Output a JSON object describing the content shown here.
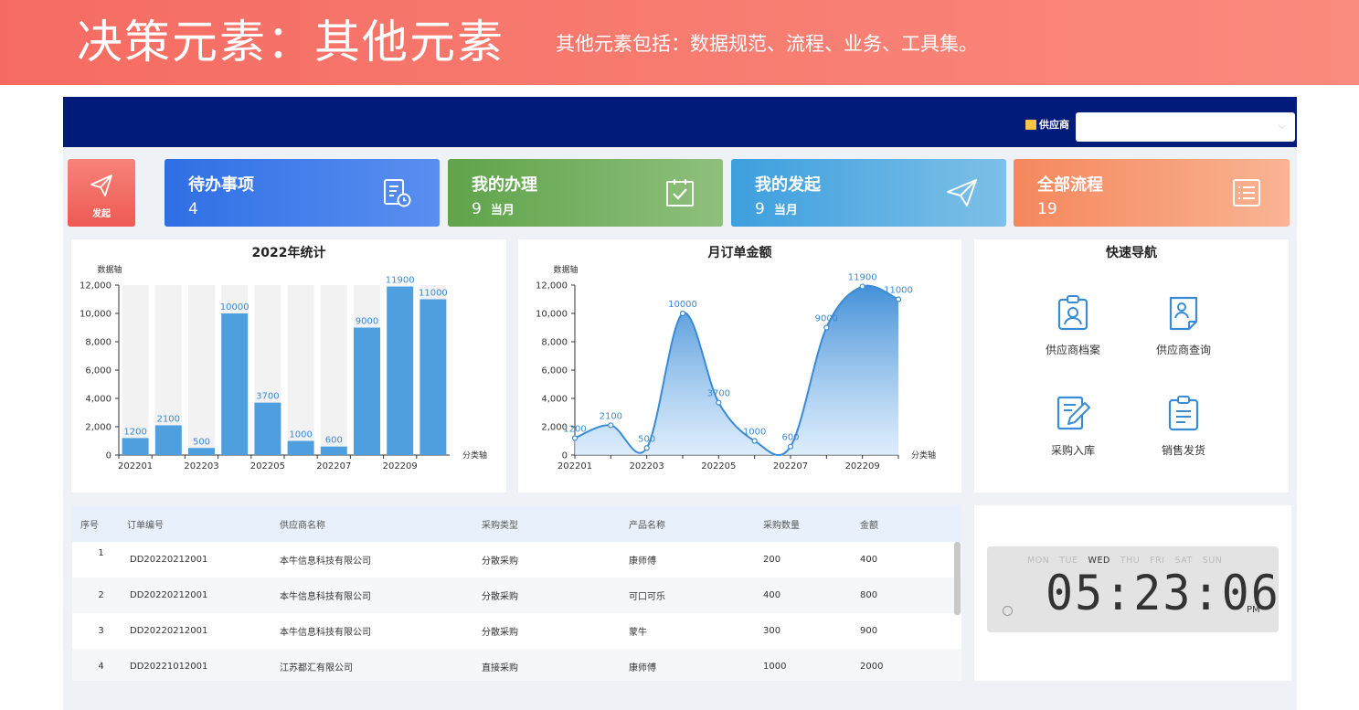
{
  "banner": {
    "title": "决策元素：其他元素",
    "subtitle": "其他元素包括：数据规范、流程、业务、工具集。"
  },
  "topbar": {
    "supplier_label": "供应商",
    "supplier_select_value": ""
  },
  "launch": {
    "label": "发起"
  },
  "cards": [
    {
      "label": "待办事项",
      "count": "4",
      "suffix": "",
      "color": "#3574e6"
    },
    {
      "label": "我的办理",
      "count": "9",
      "suffix": "当月",
      "color": "#6cb05a"
    },
    {
      "label": "我的发起",
      "count": "9",
      "suffix": "当月",
      "color": "#43a7e0"
    },
    {
      "label": "全部流程",
      "count": "19",
      "suffix": "",
      "color": "#f79466"
    }
  ],
  "chart_data": [
    {
      "type": "bar",
      "title": "2022年统计",
      "ylabel": "数据轴",
      "xlabel": "分类轴",
      "categories": [
        "202201",
        "202202",
        "202203",
        "202204",
        "202205",
        "202206",
        "202207",
        "202208",
        "202209",
        "202210"
      ],
      "x_tick_labels": [
        "202201",
        "202203",
        "202205",
        "202207",
        "202209"
      ],
      "y_tick_labels": [
        "0",
        "2,000",
        "4,000",
        "6,000",
        "8,000",
        "10,000",
        "12,000"
      ],
      "values": [
        1200,
        2100,
        500,
        10000,
        3700,
        1000,
        600,
        9000,
        11900,
        11000
      ],
      "ylim": [
        0,
        12000
      ],
      "bar_color": "#4d9fe0",
      "background_bar_color": "#f2f2f2"
    },
    {
      "type": "area",
      "title": "月订单金额",
      "ylabel": "数据轴",
      "xlabel": "分类轴",
      "categories": [
        "202201",
        "202202",
        "202203",
        "202204",
        "202205",
        "202206",
        "202207",
        "202208",
        "202209",
        "202210"
      ],
      "x_tick_labels": [
        "202201",
        "202203",
        "202205",
        "202207",
        "202209"
      ],
      "y_tick_labels": [
        "0",
        "2,000",
        "4,000",
        "6,000",
        "8,000",
        "10,000",
        "12,000"
      ],
      "values": [
        1200,
        2100,
        500,
        10000,
        3700,
        1000,
        600,
        9000,
        11900,
        11000
      ],
      "ylim": [
        0,
        12000
      ],
      "line_color": "#3a8bd6"
    }
  ],
  "quick_nav": {
    "title": "快速导航",
    "items": [
      {
        "label": "供应商档案",
        "icon": "supplier-profile-icon"
      },
      {
        "label": "供应商查询",
        "icon": "supplier-query-icon"
      },
      {
        "label": "采购入库",
        "icon": "purchase-inbound-icon"
      },
      {
        "label": "销售发货",
        "icon": "sales-shipping-icon"
      }
    ]
  },
  "table": {
    "headers": [
      "序号",
      "订单编号",
      "供应商名称",
      "采购类型",
      "产品名称",
      "采购数量",
      "金额"
    ],
    "rows": [
      [
        "1",
        "DD20220212001",
        "本牛信息科技有限公司",
        "分散采购",
        "康师傅",
        "200",
        "400"
      ],
      [
        "2",
        "DD20220212001",
        "本牛信息科技有限公司",
        "分散采购",
        "可口可乐",
        "400",
        "800"
      ],
      [
        "3",
        "DD20220212001",
        "本牛信息科技有限公司",
        "分散采购",
        "蒙牛",
        "300",
        "900"
      ],
      [
        "4",
        "DD20221012001",
        "江苏都汇有限公司",
        "直接采购",
        "康师傅",
        "1000",
        "2000"
      ]
    ]
  },
  "clock": {
    "days": [
      "MON",
      "TUE",
      "WED",
      "THU",
      "FRI",
      "SAT",
      "SUN"
    ],
    "active_day": "WED",
    "time": "05:23:06",
    "ampm": "PM"
  }
}
